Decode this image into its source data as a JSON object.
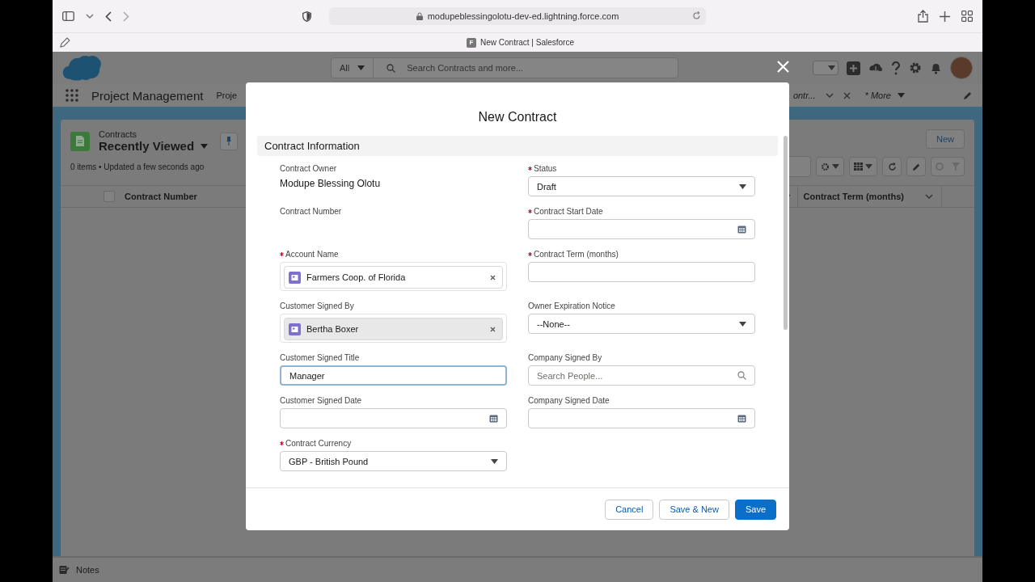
{
  "browser": {
    "url": "modupeblessingolotu-dev-ed.lightning.force.com",
    "favicon": "F",
    "tab_title": "New Contract | Salesforce"
  },
  "header": {
    "search": {
      "scope": "All",
      "placeholder": "Search Contracts and more..."
    }
  },
  "nav": {
    "app_name": "Project Management",
    "items": [
      {
        "label": "Proje"
      }
    ],
    "tabs": [
      {
        "label": "ontr..."
      }
    ],
    "more": "* More"
  },
  "list_view": {
    "object": "Contracts",
    "title": "Recently Viewed",
    "status": "0 items • Updated a few seconds ago",
    "new_button": "New",
    "select_all": {
      "checked": false
    },
    "columns": [
      {
        "label": "Contract Number"
      },
      {
        "label": "Contract Term (months)"
      }
    ]
  },
  "modal": {
    "title": "New Contract",
    "section": "Contract Information",
    "fields": [
      {
        "label": "Contract Owner",
        "required": false,
        "kind": "static",
        "value": "Modupe Blessing Olotu"
      },
      {
        "label": "Status",
        "required": true,
        "kind": "select",
        "value": "Draft"
      },
      {
        "label": "Contract Number",
        "required": false,
        "kind": "empty"
      },
      {
        "label": "Contract Start Date",
        "required": true,
        "kind": "date"
      },
      {
        "label": "Account Name",
        "required": true,
        "kind": "lookup",
        "value": "Farmers Coop. of Florida",
        "hovered": false
      },
      {
        "label": "Contract Term (months)",
        "required": true,
        "kind": "text",
        "focused": false
      },
      {
        "label": "Customer Signed By",
        "required": false,
        "kind": "lookup",
        "value": "Bertha Boxer",
        "hovered": true
      },
      {
        "label": "Owner Expiration Notice",
        "required": false,
        "kind": "select",
        "value": "--None--"
      },
      {
        "label": "Customer Signed Title",
        "required": false,
        "kind": "text",
        "value": "Manager",
        "focused": true
      },
      {
        "label": "Company Signed By",
        "required": false,
        "kind": "search",
        "placeholder": "Search People..."
      },
      {
        "label": "Customer Signed Date",
        "required": false,
        "kind": "date"
      },
      {
        "label": "Company Signed Date",
        "required": false,
        "kind": "date"
      },
      {
        "label": "Contract Currency",
        "required": true,
        "kind": "select",
        "value": "GBP - British Pound"
      }
    ],
    "buttons": [
      {
        "label": "Cancel",
        "kind": "neutral"
      },
      {
        "label": "Save & New",
        "kind": "neutral"
      },
      {
        "label": "Save",
        "kind": "brand"
      }
    ]
  },
  "utility_bar": {
    "items": [
      {
        "label": "Notes"
      }
    ]
  }
}
